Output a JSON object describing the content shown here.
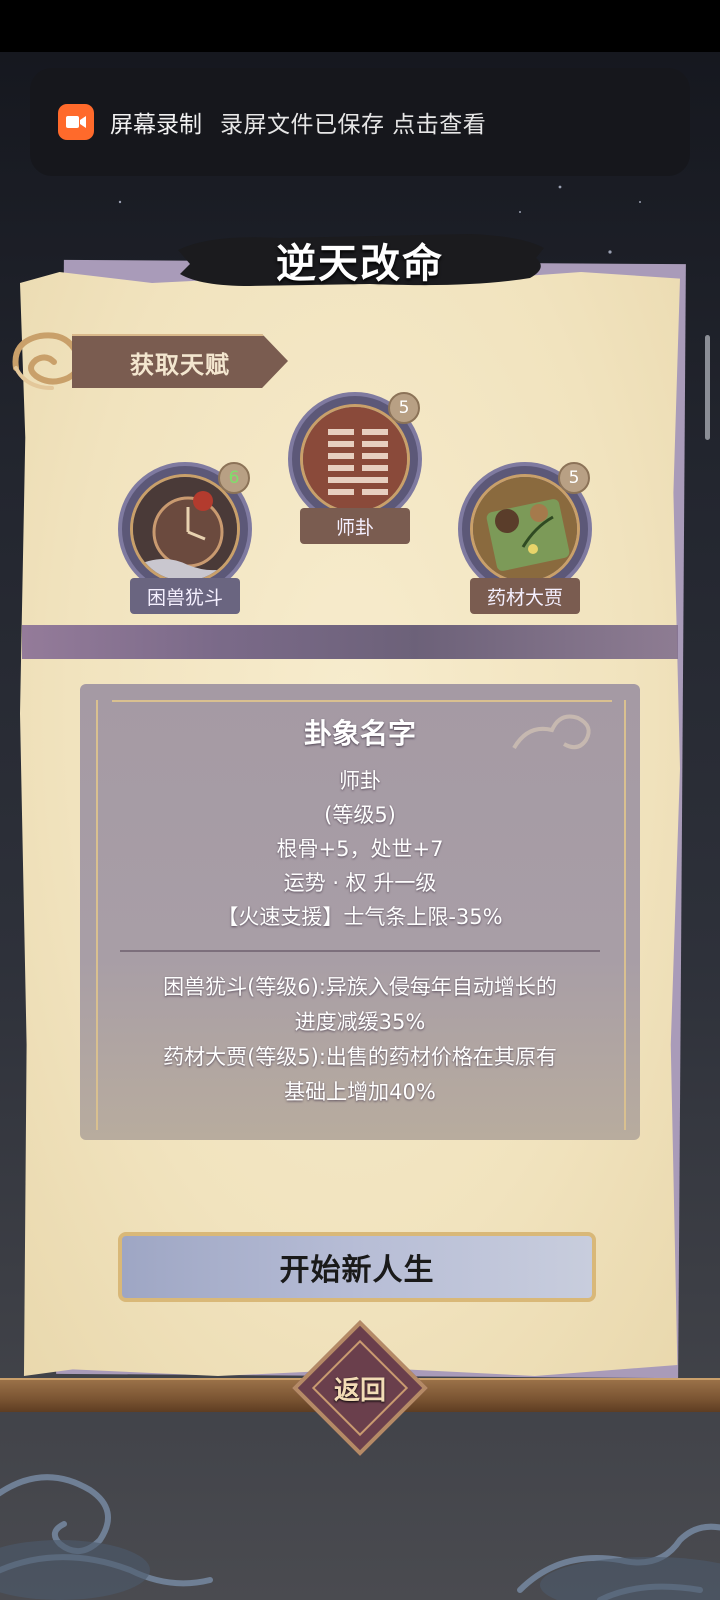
{
  "notification": {
    "title": "屏幕录制",
    "message": "录屏文件已保存 点击查看",
    "icon": "video-camera-icon",
    "icon_color": "#ff6a2b"
  },
  "header": {
    "title": "逆天改命"
  },
  "talents_section": {
    "label": "获取天赋",
    "items": [
      {
        "name": "困兽犹斗",
        "level": "6",
        "level_color": "#7ee06b",
        "icon": "clock-tower-icon"
      },
      {
        "name": "师卦",
        "level": "5",
        "icon": "hexagram-icon"
      },
      {
        "name": "药材大贾",
        "level": "5",
        "icon": "herbs-icon"
      }
    ]
  },
  "description": {
    "title": "卦象名字",
    "lines": [
      "师卦",
      "(等级5)",
      "根骨+5，处世+7",
      "运势 · 权 升一级",
      "【火速支援】士气条上限-35%"
    ],
    "effects": [
      "困兽犹斗(等级6):异族入侵每年自动增长的",
      "进度减缓35%",
      "药材大贾(等级5):出售的药材价格在其原有",
      "基础上增加40%"
    ]
  },
  "start_button": {
    "label": "开始新人生"
  },
  "return_button": {
    "label": "返回"
  }
}
